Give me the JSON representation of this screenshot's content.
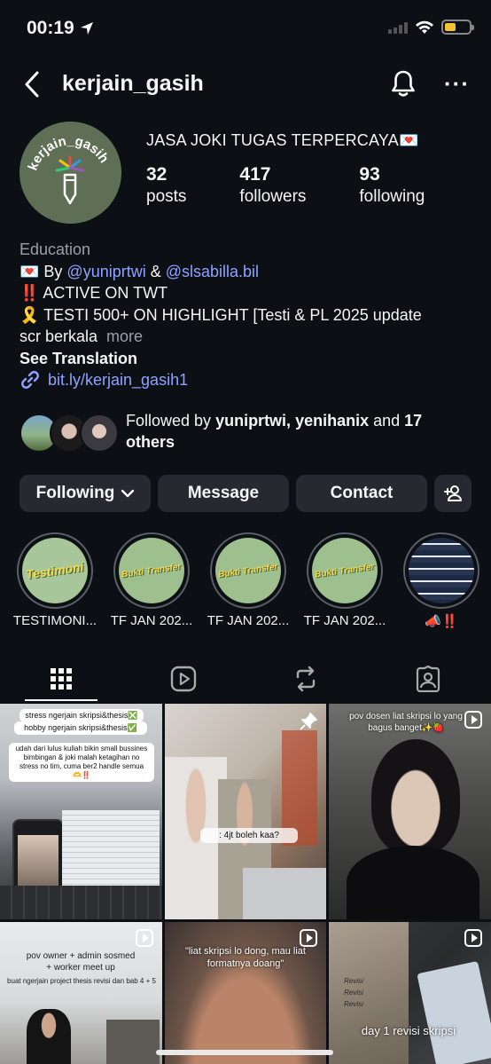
{
  "status": {
    "time": "00:19"
  },
  "header": {
    "username": "kerjain_gasih"
  },
  "profile": {
    "avatar_text": "kerjain_gasih",
    "display_name": "JASA JOKI TUGAS TERPERCAYA💌",
    "stats": [
      {
        "value": "32",
        "label": "posts"
      },
      {
        "value": "417",
        "label": "followers"
      },
      {
        "value": "93",
        "label": "following"
      }
    ],
    "category": "Education",
    "bio": {
      "line1_prefix": "💌 By ",
      "mention1": "@yuniprtwi",
      "line1_mid": " & ",
      "mention2": "@slsabilla.bil",
      "line2": "‼️ ACTIVE ON TWT",
      "line3": "🎗️ TESTI 500+ ON HIGHLIGHT [Testi & PL 2025 update",
      "line4": "scr berkala",
      "more": "more",
      "see_translation": "See Translation",
      "link": "bit.ly/kerjain_gasih1"
    },
    "followed_by": {
      "prefix": "Followed by ",
      "names": "yuniprtwi, yenihanix",
      "mid": " and ",
      "others": "17 others"
    }
  },
  "actions": {
    "following": "Following",
    "message": "Message",
    "contact": "Contact"
  },
  "highlights": [
    {
      "label": "TESTIMONI...",
      "cover": "Testimoni"
    },
    {
      "label": "TF JAN 202...",
      "cover": "Bukti Transfer"
    },
    {
      "label": "TF JAN 202...",
      "cover": "Bukti Transfer"
    },
    {
      "label": "TF JAN 202...",
      "cover": "Bukti Transfer"
    },
    {
      "label": "📣‼️",
      "cover": ""
    }
  ],
  "tabs": [
    "grid-icon",
    "reels-icon",
    "reposts-icon",
    "tagged-icon"
  ],
  "posts": {
    "p1_cap1": "stress ngerjain skripsi&thesis❎",
    "p1_cap2": "hobby ngerjain skripsi&thesis✅",
    "p1_cap3": "udah dari lulus kuliah bikin small bussines bimbingan & joki malah ketagihan no stress no tim, cuma ber2 handle semua🫶‼️",
    "p2_text": ": 4jt boleh kaa?",
    "p3_text": "pov dosen liat skripsi lo yang bagus banget✨🍓",
    "p4_text": "pov owner + admin sosmed + worker meet up",
    "p4_sub": "buat ngerjain project thesis revisi dan bab 4 + 5",
    "p5_text": "\"liat skripsi lo dong, mau liat formatnya doang\"",
    "p6_text": "day 1 revisi skripsi",
    "p6_note": "Revisi Revisi Revisi"
  }
}
